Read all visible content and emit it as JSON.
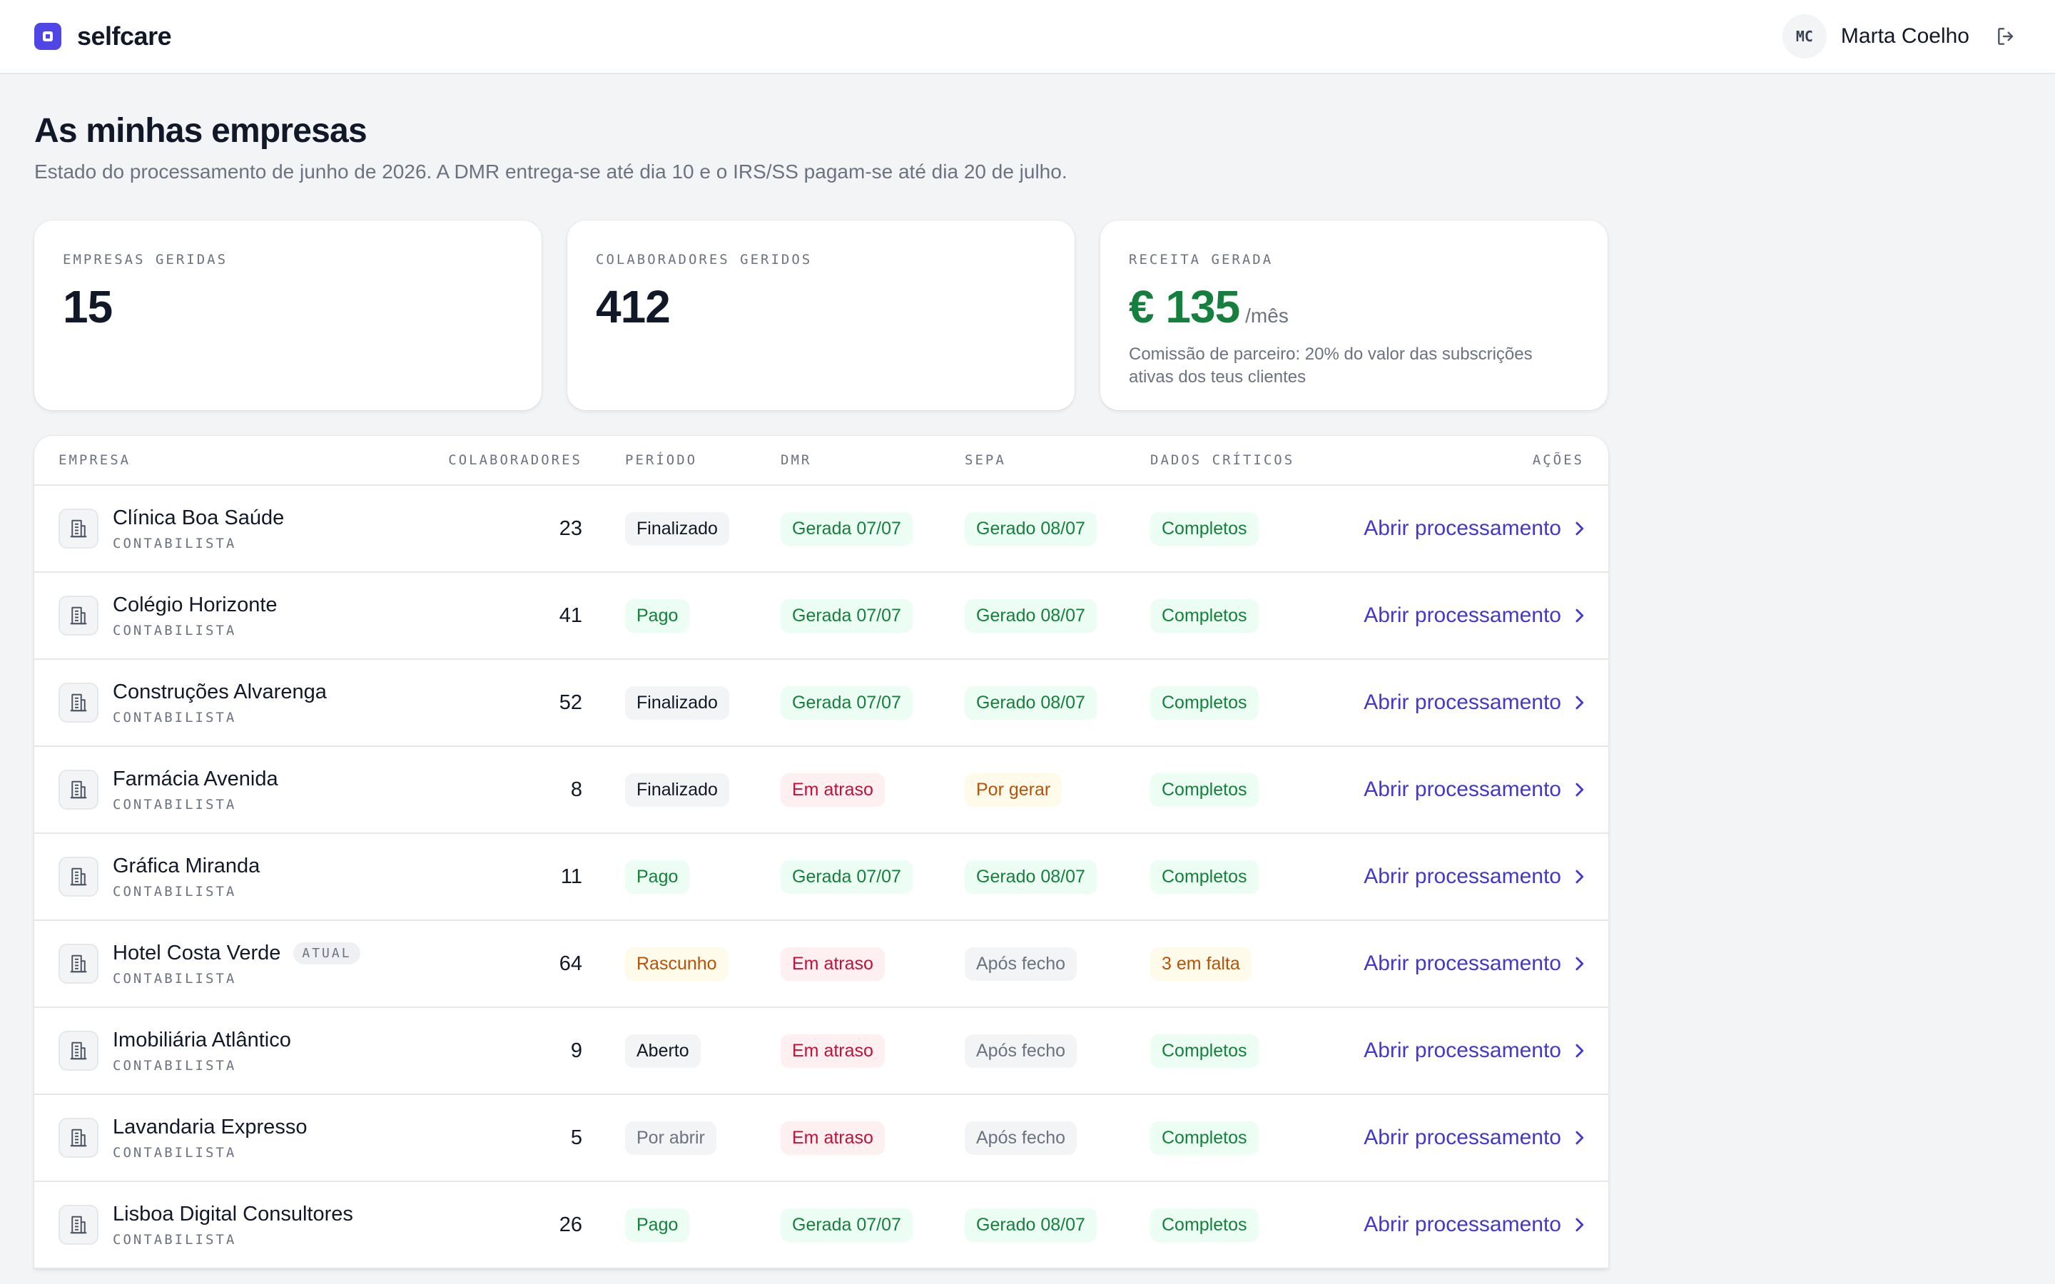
{
  "app": {
    "name": "selfcare"
  },
  "user": {
    "initials": "MC",
    "name": "Marta Coelho"
  },
  "page": {
    "title": "As minhas empresas",
    "subtitle": "Estado do processamento de junho de 2026. A DMR entrega-se até dia 10 e o IRS/SS pagam-se até dia 20 de julho."
  },
  "stats": {
    "empresas": {
      "label": "EMPRESAS GERIDAS",
      "value": "15"
    },
    "colaboradores": {
      "label": "COLABORADORES GERIDOS",
      "value": "412"
    },
    "receita": {
      "label": "RECEITA GERADA",
      "value": "€ 135",
      "unit": "/mês",
      "note": "Comissão de parceiro: 20% do valor das subscrições ativas dos teus clientes"
    }
  },
  "table": {
    "headers": {
      "empresa": "EMPRESA",
      "colaboradores": "COLABORADORES",
      "periodo": "PERÍODO",
      "dmr": "DMR",
      "sepa": "SEPA",
      "dados": "DADOS CRÍTICOS",
      "acoes": "AÇÕES"
    },
    "action_label": "Abrir processamento",
    "current_badge": "ATUAL",
    "rows": [
      {
        "name": "Clínica Boa Saúde",
        "role": "CONTABILISTA",
        "colaboradores": "23",
        "periodo": "Finalizado",
        "periodo_style": "neutral",
        "dmr": "Gerada 07/07",
        "dmr_style": "green",
        "sepa": "Gerado 08/07",
        "sepa_style": "green",
        "dados": "Completos",
        "dados_style": "green",
        "current": false
      },
      {
        "name": "Colégio Horizonte",
        "role": "CONTABILISTA",
        "colaboradores": "41",
        "periodo": "Pago",
        "periodo_style": "green",
        "dmr": "Gerada 07/07",
        "dmr_style": "green",
        "sepa": "Gerado 08/07",
        "sepa_style": "green",
        "dados": "Completos",
        "dados_style": "green",
        "current": false
      },
      {
        "name": "Construções Alvarenga",
        "role": "CONTABILISTA",
        "colaboradores": "52",
        "periodo": "Finalizado",
        "periodo_style": "neutral",
        "dmr": "Gerada 07/07",
        "dmr_style": "green",
        "sepa": "Gerado 08/07",
        "sepa_style": "green",
        "dados": "Completos",
        "dados_style": "green",
        "current": false
      },
      {
        "name": "Farmácia Avenida",
        "role": "CONTABILISTA",
        "colaboradores": "8",
        "periodo": "Finalizado",
        "periodo_style": "neutral",
        "dmr": "Em atraso",
        "dmr_style": "red",
        "sepa": "Por gerar",
        "sepa_style": "amber",
        "dados": "Completos",
        "dados_style": "green",
        "current": false
      },
      {
        "name": "Gráfica Miranda",
        "role": "CONTABILISTA",
        "colaboradores": "11",
        "periodo": "Pago",
        "periodo_style": "green",
        "dmr": "Gerada 07/07",
        "dmr_style": "green",
        "sepa": "Gerado 08/07",
        "sepa_style": "green",
        "dados": "Completos",
        "dados_style": "green",
        "current": false
      },
      {
        "name": "Hotel Costa Verde",
        "role": "CONTABILISTA",
        "colaboradores": "64",
        "periodo": "Rascunho",
        "periodo_style": "amber",
        "dmr": "Em atraso",
        "dmr_style": "red",
        "sepa": "Após fecho",
        "sepa_style": "muted",
        "dados": "3 em falta",
        "dados_style": "amber",
        "current": true
      },
      {
        "name": "Imobiliária Atlântico",
        "role": "CONTABILISTA",
        "colaboradores": "9",
        "periodo": "Aberto",
        "periodo_style": "neutral",
        "dmr": "Em atraso",
        "dmr_style": "red",
        "sepa": "Após fecho",
        "sepa_style": "muted",
        "dados": "Completos",
        "dados_style": "green",
        "current": false
      },
      {
        "name": "Lavandaria Expresso",
        "role": "CONTABILISTA",
        "colaboradores": "5",
        "periodo": "Por abrir",
        "periodo_style": "muted",
        "dmr": "Em atraso",
        "dmr_style": "red",
        "sepa": "Após fecho",
        "sepa_style": "muted",
        "dados": "Completos",
        "dados_style": "green",
        "current": false
      },
      {
        "name": "Lisboa Digital Consultores",
        "role": "CONTABILISTA",
        "colaboradores": "26",
        "periodo": "Pago",
        "periodo_style": "green",
        "dmr": "Gerada 07/07",
        "dmr_style": "green",
        "sepa": "Gerado 08/07",
        "sepa_style": "green",
        "dados": "Completos",
        "dados_style": "green",
        "current": false
      }
    ]
  },
  "icons": {
    "brand": "square-logo-icon",
    "logout": "logout-icon",
    "company": "building-icon",
    "row_action": "chevron-right-icon"
  },
  "colors": {
    "accent": "#4f46e5",
    "link": "#4338ca",
    "success": "#15803d",
    "danger": "#be123c",
    "warning": "#b45309"
  }
}
